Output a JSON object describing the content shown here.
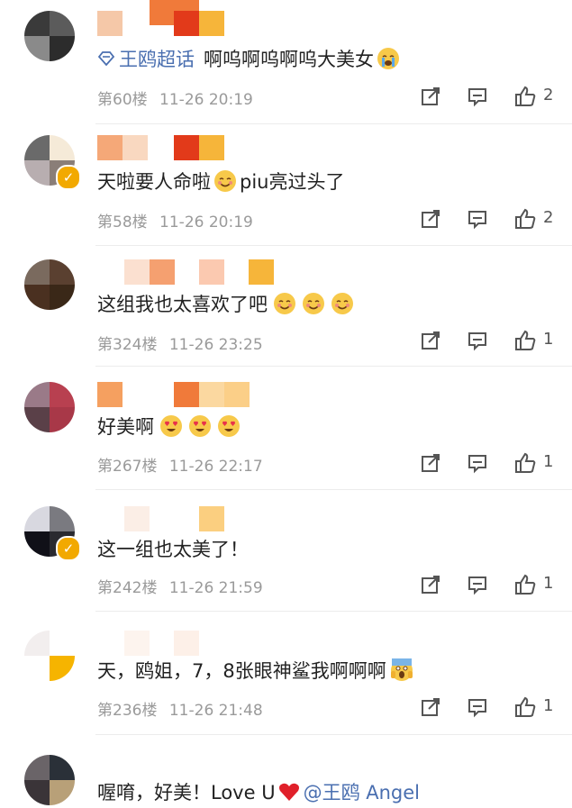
{
  "comments": [
    {
      "tag": "王鸥超话",
      "text": "啊呜啊呜啊呜大美女",
      "floor": "第60楼",
      "time": "11-26 20:19",
      "likes": "2"
    },
    {
      "text_a": "天啦要人命啦",
      "text_b": "piu亮过头了",
      "floor": "第58楼",
      "time": "11-26 20:19",
      "likes": "2"
    },
    {
      "text": "这组我也太喜欢了吧",
      "floor": "第324楼",
      "time": "11-26 23:25",
      "likes": "1"
    },
    {
      "text": "好美啊",
      "floor": "第267楼",
      "time": "11-26 22:17",
      "likes": "1"
    },
    {
      "text": "这一组也太美了！",
      "floor": "第242楼",
      "time": "11-26 21:59",
      "likes": "1"
    },
    {
      "text": "天，鸥姐，7，8张眼神鲨我啊啊啊",
      "floor": "第236楼",
      "time": "11-26 21:48",
      "likes": "1"
    },
    {
      "text": "喔唷，好美！Love U",
      "mention": "@王鸥 Angel"
    }
  ],
  "icons": {
    "superchat": "diamond-icon",
    "share": "share-icon",
    "reply": "comment-icon",
    "like": "thumb-up-icon"
  },
  "colors": {
    "link": "#4a6fb0",
    "meta": "#9a9a9a",
    "badge": "#f2a900"
  }
}
